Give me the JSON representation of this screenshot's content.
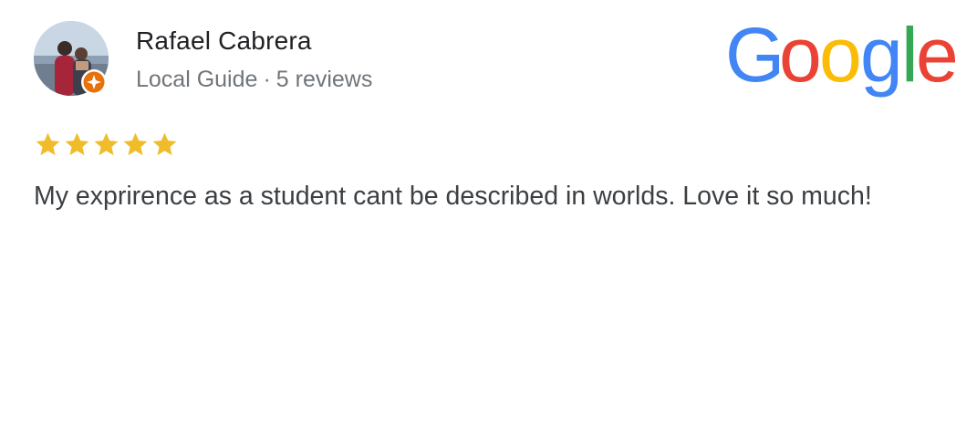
{
  "reviewer": {
    "name": "Rafael Cabrera",
    "level": "Local Guide",
    "separator": "·",
    "reviews_count": "5 reviews",
    "avatar_icon": "person-photo",
    "badge_icon": "local-guide-badge-icon"
  },
  "brand": {
    "name": "Google",
    "colors": {
      "blue": "#4285F4",
      "red": "#EA4335",
      "yellow": "#FBBC05",
      "green": "#34A853"
    }
  },
  "review": {
    "rating": 5,
    "rating_max": 5,
    "star_color": "#F0BC2C",
    "text": "My exprirence as a student cant be described in worlds. Love it so much!"
  }
}
